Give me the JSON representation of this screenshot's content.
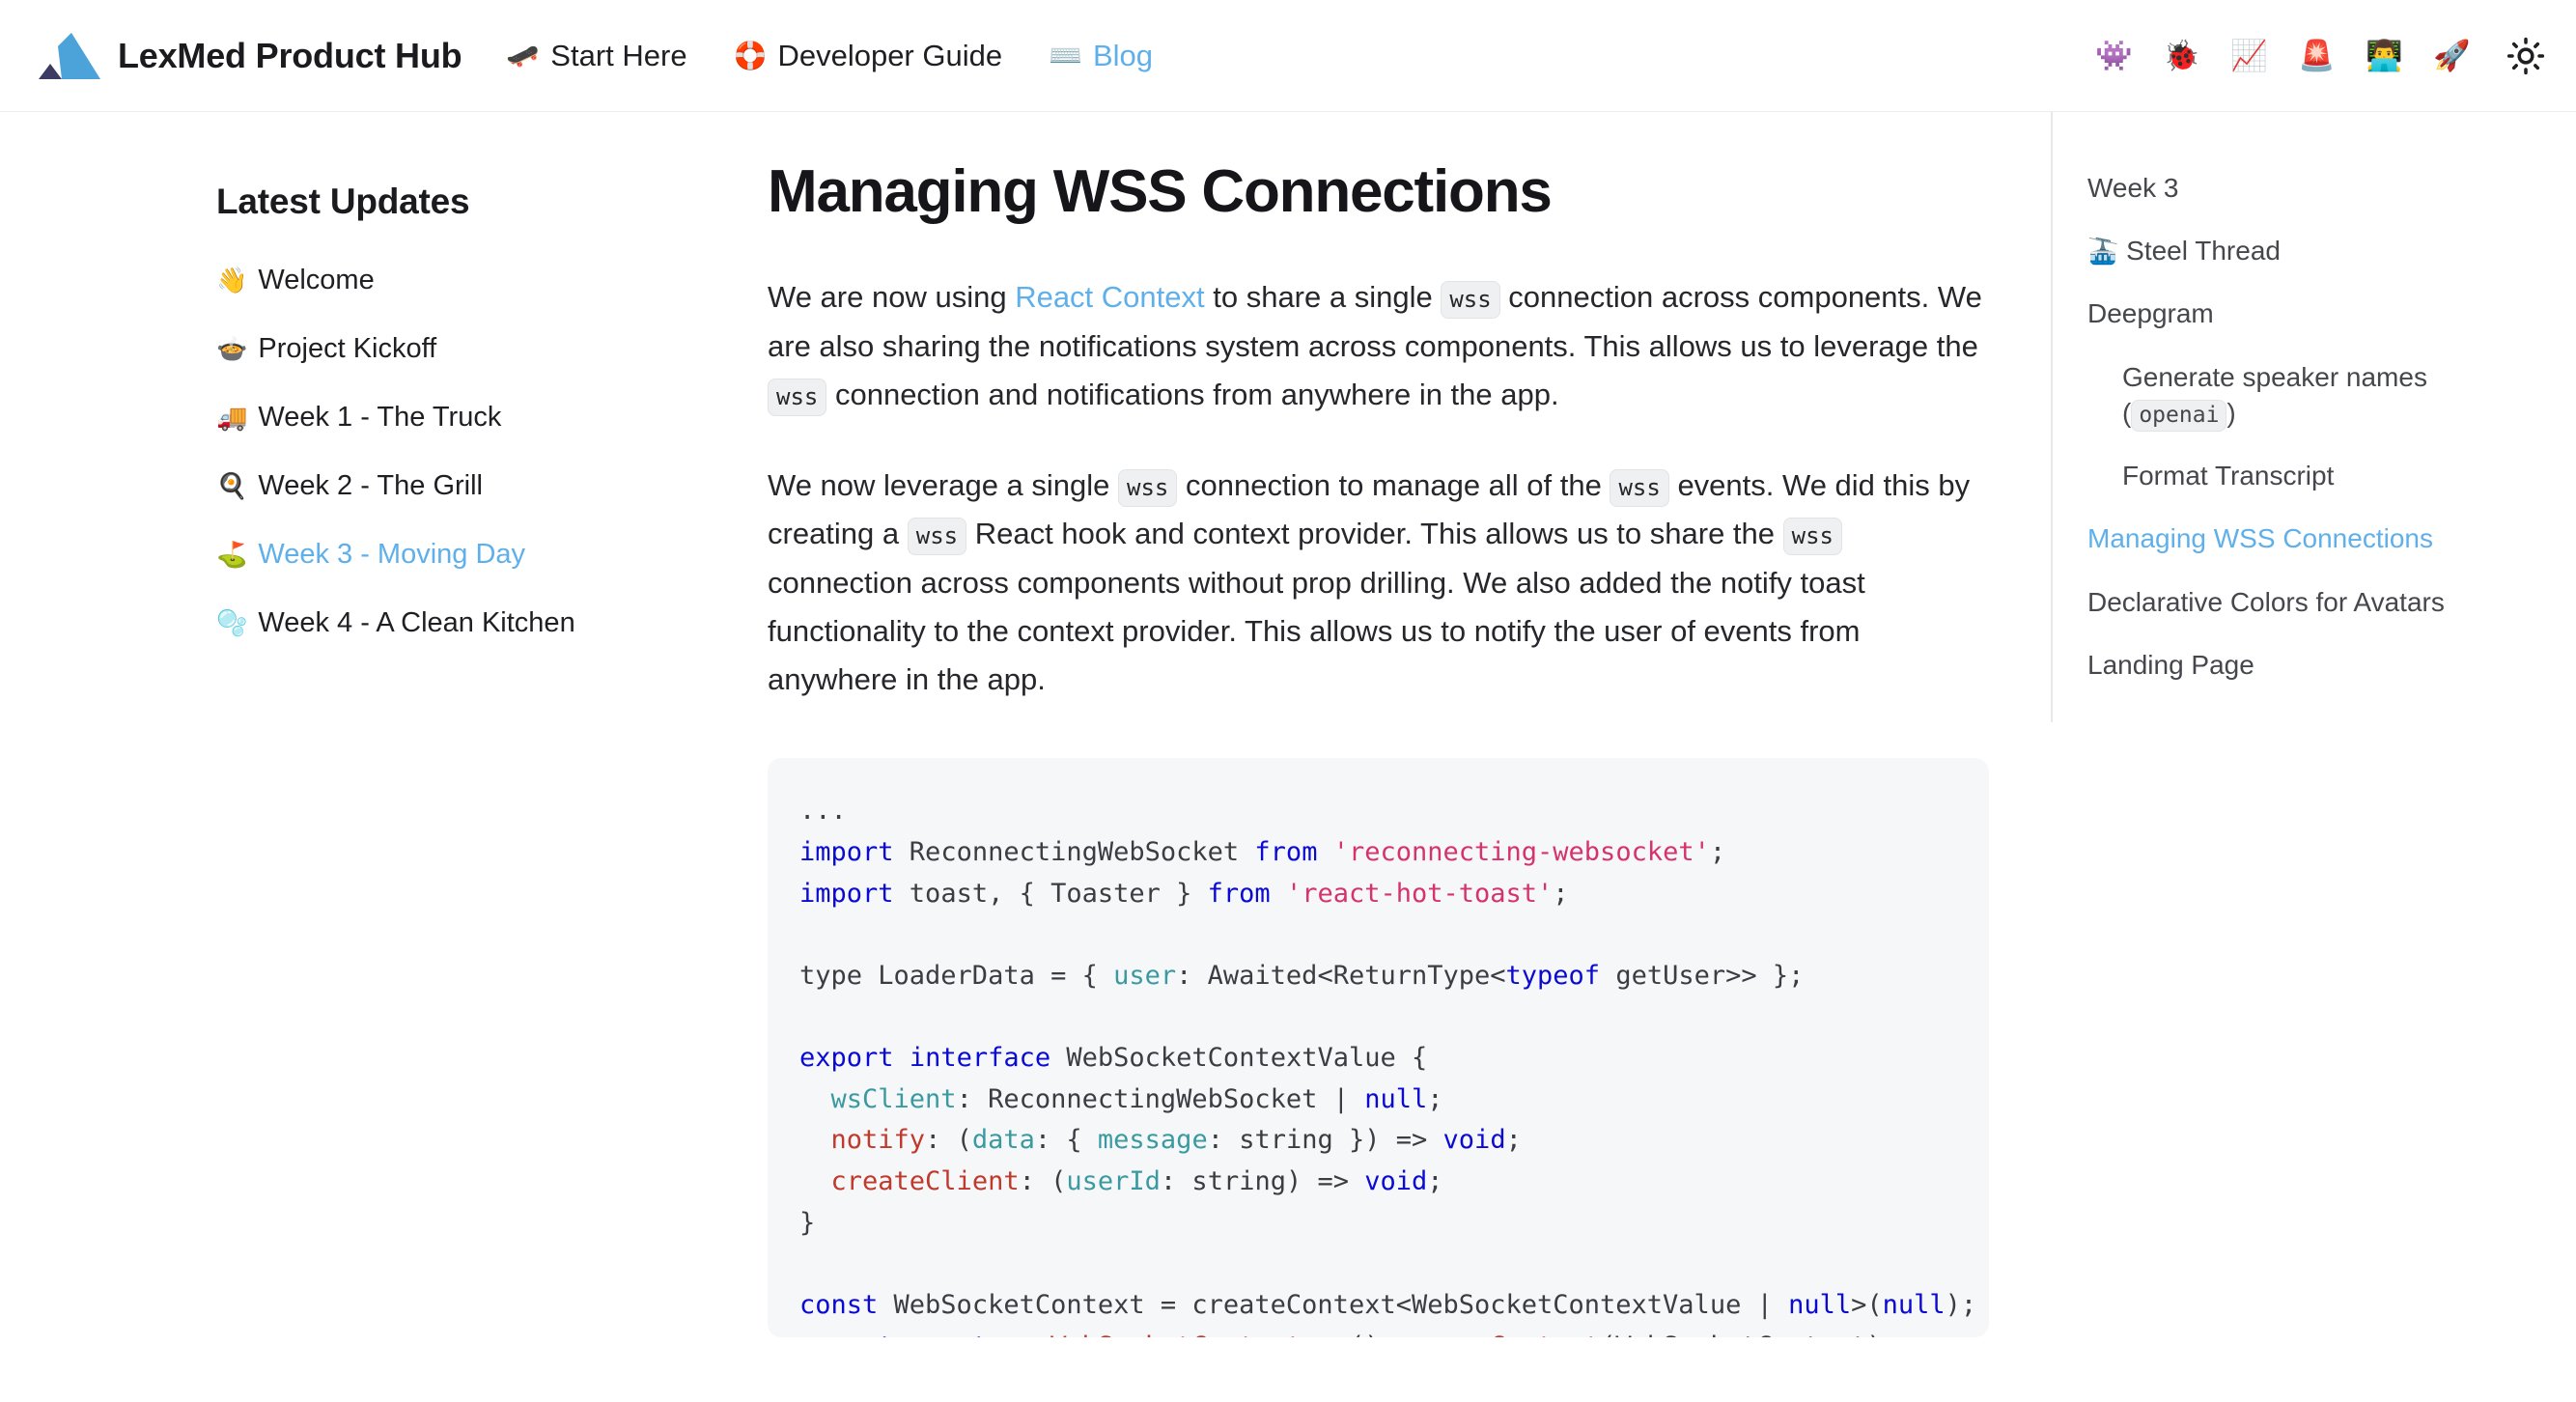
{
  "header": {
    "brand_title": "LexMed Product Hub",
    "logo_colors": {
      "primary": "#4ba3d9",
      "secondary": "#3b3b63"
    },
    "nav": [
      {
        "emoji": "🛹",
        "icon_name": "skateboard-icon",
        "label": "Start Here",
        "active": false
      },
      {
        "emoji": "🛟",
        "icon_name": "ring-buoy-icon",
        "label": "Developer Guide",
        "active": false
      },
      {
        "emoji": "⌨️",
        "icon_name": "keyboard-icon",
        "label": "Blog",
        "active": true
      }
    ],
    "tools": [
      {
        "emoji": "👾",
        "icon_name": "alien-monster-icon"
      },
      {
        "emoji": "🐞",
        "icon_name": "lady-beetle-icon"
      },
      {
        "emoji": "📈",
        "icon_name": "chart-increasing-icon"
      },
      {
        "emoji": "🚨",
        "icon_name": "police-light-icon"
      },
      {
        "emoji": "👨‍💻",
        "icon_name": "technologist-icon"
      },
      {
        "emoji": "🚀",
        "icon_name": "rocket-icon"
      }
    ],
    "theme_toggle_icon": "sun-icon",
    "active_color": "#5fb0ea"
  },
  "sidebar": {
    "heading": "Latest Updates",
    "items": [
      {
        "emoji": "👋",
        "icon_name": "waving-hand-icon",
        "label": "Welcome",
        "active": false
      },
      {
        "emoji": "🍲",
        "icon_name": "pot-of-food-icon",
        "label": "Project Kickoff",
        "active": false
      },
      {
        "emoji": "🚚",
        "icon_name": "delivery-truck-icon",
        "label": "Week 1 - The Truck",
        "active": false
      },
      {
        "emoji": "🍳",
        "icon_name": "cooking-pan-icon",
        "label": "Week 2 - The Grill",
        "active": false
      },
      {
        "emoji": "⛳",
        "icon_name": "flag-in-hole-icon",
        "label": "Week 3 - Moving Day",
        "active": true
      },
      {
        "emoji": "🫧",
        "icon_name": "bubbles-icon",
        "label": "Week 4 - A Clean Kitchen",
        "active": false
      }
    ]
  },
  "article": {
    "title": "Managing WSS Connections",
    "para1": {
      "a": "We are now using ",
      "link": "React Context",
      "b": " to share a single ",
      "code1": "wss",
      "c": " connection across components. We are also sharing the notifications system across components. This allows us to leverage the ",
      "code2": "wss",
      "d": " connection and notifications from anywhere in the app."
    },
    "para2": {
      "a": "We now leverage a single ",
      "code1": "wss",
      "b": " connection to manage all of the ",
      "code2": "wss",
      "c": " events. We did this by creating a ",
      "code3": "wss",
      "d": " React hook and context provider. This allows us to share the ",
      "code4": "wss",
      "e": " connection across components without prop drilling. We also added the notify toast functionality to the context provider. This allows us to notify the user of events from anywhere in the app."
    }
  },
  "code_block": {
    "language": "typescript",
    "lines": [
      {
        "segs": [
          {
            "t": "...",
            "c": "tok-txt"
          }
        ]
      },
      {
        "segs": [
          {
            "t": "import",
            "c": "tok-kw"
          },
          {
            "t": " ReconnectingWebSocket ",
            "c": "tok-txt"
          },
          {
            "t": "from",
            "c": "tok-kw"
          },
          {
            "t": " ",
            "c": "tok-txt"
          },
          {
            "t": "'reconnecting-websocket'",
            "c": "tok-str"
          },
          {
            "t": ";",
            "c": "tok-txt"
          }
        ]
      },
      {
        "segs": [
          {
            "t": "import",
            "c": "tok-kw"
          },
          {
            "t": " toast, { Toaster } ",
            "c": "tok-txt"
          },
          {
            "t": "from",
            "c": "tok-kw"
          },
          {
            "t": " ",
            "c": "tok-txt"
          },
          {
            "t": "'react-hot-toast'",
            "c": "tok-str"
          },
          {
            "t": ";",
            "c": "tok-txt"
          }
        ]
      },
      {
        "segs": [
          {
            "t": "",
            "c": "tok-txt"
          }
        ]
      },
      {
        "segs": [
          {
            "t": "type LoaderData = { ",
            "c": "tok-txt"
          },
          {
            "t": "user",
            "c": "tok-prop"
          },
          {
            "t": ": Awaited<ReturnType<",
            "c": "tok-txt"
          },
          {
            "t": "typeof",
            "c": "tok-kw"
          },
          {
            "t": " getUser>> };",
            "c": "tok-txt"
          }
        ]
      },
      {
        "segs": [
          {
            "t": "",
            "c": "tok-txt"
          }
        ]
      },
      {
        "segs": [
          {
            "t": "export",
            "c": "tok-kw"
          },
          {
            "t": " ",
            "c": "tok-txt"
          },
          {
            "t": "interface",
            "c": "tok-kw"
          },
          {
            "t": " WebSocketContextValue {",
            "c": "tok-txt"
          }
        ]
      },
      {
        "segs": [
          {
            "t": "  ",
            "c": "tok-txt"
          },
          {
            "t": "wsClient",
            "c": "tok-prop"
          },
          {
            "t": ": ReconnectingWebSocket | ",
            "c": "tok-txt"
          },
          {
            "t": "null",
            "c": "tok-kw"
          },
          {
            "t": ";",
            "c": "tok-txt"
          }
        ]
      },
      {
        "segs": [
          {
            "t": "  ",
            "c": "tok-txt"
          },
          {
            "t": "notify",
            "c": "tok-fn"
          },
          {
            "t": ": (",
            "c": "tok-txt"
          },
          {
            "t": "data",
            "c": "tok-prop"
          },
          {
            "t": ": { ",
            "c": "tok-txt"
          },
          {
            "t": "message",
            "c": "tok-prop"
          },
          {
            "t": ": string }) => ",
            "c": "tok-txt"
          },
          {
            "t": "void",
            "c": "tok-kw"
          },
          {
            "t": ";",
            "c": "tok-txt"
          }
        ]
      },
      {
        "segs": [
          {
            "t": "  ",
            "c": "tok-txt"
          },
          {
            "t": "createClient",
            "c": "tok-fn"
          },
          {
            "t": ": (",
            "c": "tok-txt"
          },
          {
            "t": "userId",
            "c": "tok-prop"
          },
          {
            "t": ": string) => ",
            "c": "tok-txt"
          },
          {
            "t": "void",
            "c": "tok-kw"
          },
          {
            "t": ";",
            "c": "tok-txt"
          }
        ]
      },
      {
        "segs": [
          {
            "t": "}",
            "c": "tok-txt"
          }
        ]
      },
      {
        "segs": [
          {
            "t": "",
            "c": "tok-txt"
          }
        ]
      },
      {
        "segs": [
          {
            "t": "const",
            "c": "tok-kw"
          },
          {
            "t": " WebSocketContext = createContext<WebSocketContextValue | ",
            "c": "tok-txt"
          },
          {
            "t": "null",
            "c": "tok-kw"
          },
          {
            "t": ">(",
            "c": "tok-txt"
          },
          {
            "t": "null",
            "c": "tok-kw"
          },
          {
            "t": ");",
            "c": "tok-txt"
          }
        ]
      },
      {
        "segs": [
          {
            "t": "export",
            "c": "tok-kw"
          },
          {
            "t": " ",
            "c": "tok-txt"
          },
          {
            "t": "const",
            "c": "tok-kw"
          },
          {
            "t": " ",
            "c": "tok-txt"
          },
          {
            "t": "useWebSocketContext",
            "c": "tok-fn"
          },
          {
            "t": " = () => ",
            "c": "tok-txt"
          },
          {
            "t": "useContext",
            "c": "tok-fn"
          },
          {
            "t": "(WebSocketContext);",
            "c": "tok-txt"
          }
        ]
      }
    ]
  },
  "toc": {
    "entries": [
      {
        "label": "Week 3",
        "indent": false,
        "active": false
      },
      {
        "emoji": "🚠",
        "icon_name": "mountain-cableway-icon",
        "label": "Steel Thread",
        "indent": false,
        "active": false
      },
      {
        "label": "Deepgram",
        "indent": false,
        "active": false
      },
      {
        "label_before": "Generate speaker names (",
        "code": "openai",
        "label_after": ")",
        "indent": true,
        "active": false
      },
      {
        "label": "Format Transcript",
        "indent": true,
        "active": false
      },
      {
        "label": "Managing WSS Connections",
        "indent": false,
        "active": true
      },
      {
        "label": "Declarative Colors for Avatars",
        "indent": false,
        "active": false
      },
      {
        "label": "Landing Page",
        "indent": false,
        "active": false
      }
    ]
  }
}
